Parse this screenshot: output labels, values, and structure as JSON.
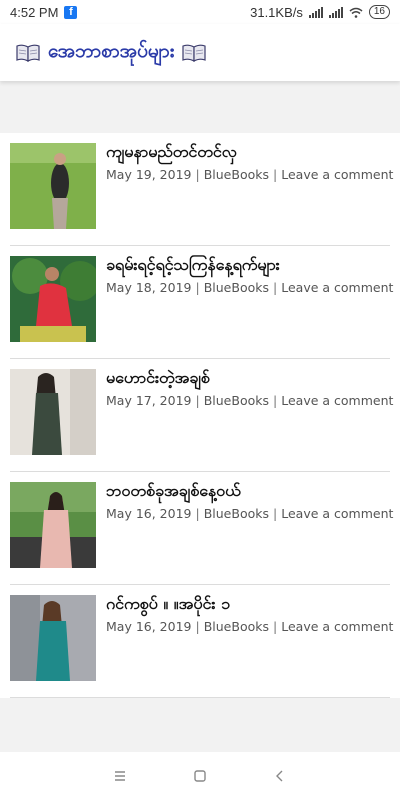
{
  "status_bar": {
    "time": "4:52 PM",
    "speed": "31.1KB/s",
    "battery": "16"
  },
  "app_bar": {
    "title": "အေဘာစာအုပ်များ"
  },
  "posts": [
    {
      "title": "ကျမနာမည်တင်တင်လှ",
      "date": "May 19, 2019",
      "author": "BlueBooks",
      "comment": "Leave a comment"
    },
    {
      "title": "ခရမ်းရင့်ရင့်သကြန်နေ့ရက်များ",
      "date": "May 18, 2019",
      "author": "BlueBooks",
      "comment": "Leave a comment"
    },
    {
      "title": "မဟောင်းတဲ့အချစ်",
      "date": "May 17, 2019",
      "author": "BlueBooks",
      "comment": "Leave a comment"
    },
    {
      "title": "ဘဝတစ်ခုအချစ်နေ့ဝယ်",
      "date": "May 16, 2019",
      "author": "BlueBooks",
      "comment": "Leave a comment"
    },
    {
      "title": "ဂင်ကစွပ် ။ ။အပိုင်း ၁",
      "date": "May 16, 2019",
      "author": "BlueBooks",
      "comment": "Leave a comment"
    }
  ],
  "meta_separator": "|",
  "colors": {
    "title_blue": "#2a3aa8",
    "background": "#f2f2f2"
  }
}
